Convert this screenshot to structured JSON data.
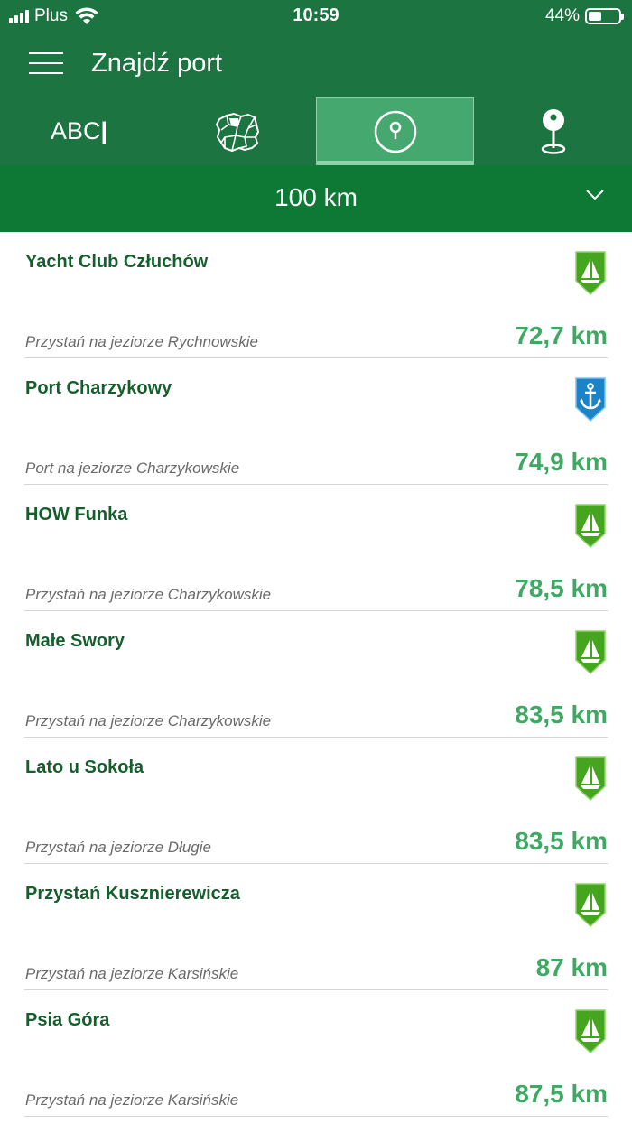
{
  "status_bar": {
    "carrier": "Plus",
    "time": "10:59",
    "battery": "44%",
    "battery_level": 0.44
  },
  "header": {
    "title": "Znajdź port"
  },
  "tabs": [
    {
      "label": "ABC",
      "icon": "abc-text-icon"
    },
    {
      "icon": "poland-map-icon"
    },
    {
      "icon": "radius-location-icon",
      "active": true
    },
    {
      "icon": "map-pin-icon"
    }
  ],
  "range": {
    "value": "100 km"
  },
  "colors": {
    "header_green": "#1c7440",
    "range_green": "#0d7935",
    "active_tab": "#45a86f",
    "name_green": "#155f2d",
    "distance_green": "#3fa964",
    "marina_marker": "#45a51f",
    "port_marker": "#1b83c8"
  },
  "ports": [
    {
      "name": "Yacht Club Człuchów",
      "description": "Przystań na jeziorze Rychnowskie",
      "distance": "72,7 km",
      "marker": "sailboat-marker-icon"
    },
    {
      "name": "Port Charzykowy",
      "description": "Port na jeziorze Charzykowskie",
      "distance": "74,9 km",
      "marker": "anchor-marker-icon"
    },
    {
      "name": "HOW Funka",
      "description": "Przystań na jeziorze Charzykowskie",
      "distance": "78,5 km",
      "marker": "sailboat-marker-icon"
    },
    {
      "name": "Małe Swory",
      "description": "Przystań na jeziorze Charzykowskie",
      "distance": "83,5 km",
      "marker": "sailboat-marker-icon"
    },
    {
      "name": "Lato u Sokoła",
      "description": "Przystań na jeziorze Długie",
      "distance": "83,5 km",
      "marker": "sailboat-marker-icon"
    },
    {
      "name": "Przystań Kusznierewicza",
      "description": "Przystań na jeziorze Karsińskie",
      "distance": "87 km",
      "marker": "sailboat-marker-icon"
    },
    {
      "name": "Psia Góra",
      "description": "Przystań na jeziorze Karsińskie",
      "distance": "87,5 km",
      "marker": "sailboat-marker-icon"
    }
  ]
}
